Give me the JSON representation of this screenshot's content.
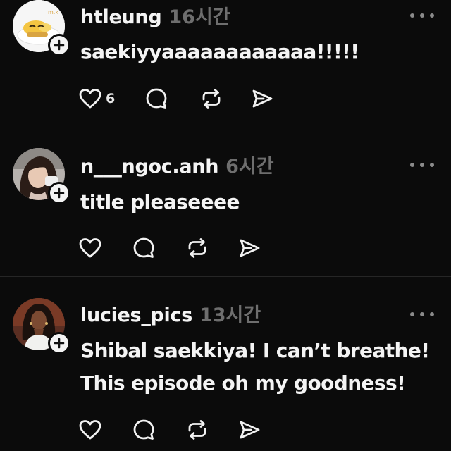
{
  "posts": [
    {
      "username": "htleung",
      "time": "16시간",
      "text_lines": [
        "saekiyyaaaaaaaaaaaa!!!!!"
      ],
      "like_count": "6",
      "avatar": "gudetama-egg-avatar"
    },
    {
      "username": "n___ngoc.anh",
      "time": "6시간",
      "text_lines": [
        "title pleaseeee"
      ],
      "like_count": "",
      "avatar": "woman-photo-avatar"
    },
    {
      "username": "lucies_pics",
      "time": "13시간",
      "text_lines": [
        "Shibal saekkiya! I can’t breathe!",
        "This episode oh my goodness!"
      ],
      "like_count": "",
      "avatar": "woman-portrait-avatar"
    }
  ],
  "icons": {
    "like": "heart-icon",
    "reply": "comment-bubble-icon",
    "repost": "repost-icon",
    "share": "send-icon",
    "more": "more-dots-icon",
    "follow": "plus-icon"
  },
  "colors": {
    "background": "#0b0b0b",
    "text": "#f4f4f4",
    "muted": "#6e6e6e",
    "divider": "#262626"
  }
}
